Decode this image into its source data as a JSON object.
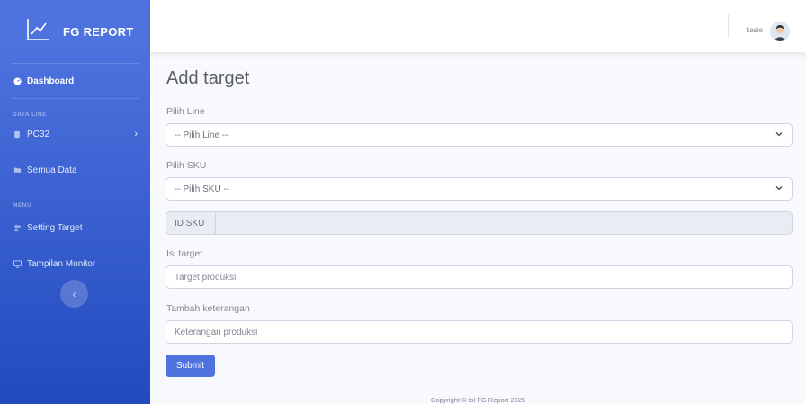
{
  "sidebar": {
    "brand": "FG REPORT",
    "dashboard": "Dashboard",
    "heading_data_line": "DATA LINE",
    "pc32": "PC32",
    "semua_data": "Semua Data",
    "heading_menu": "MENU",
    "setting_target": "Setting Target",
    "tampilan_monitor": "Tampilan Monitor"
  },
  "topbar": {
    "user": "kasie"
  },
  "form": {
    "title": "Add target",
    "line_label": "Pilih Line",
    "line_value": "-- Pilih Line --",
    "sku_label": "Pilih SKU",
    "sku_value": "-- Pilih SKU --",
    "id_sku_addon": "ID SKU",
    "target_label": "Isi target",
    "target_placeholder": "Target produksi",
    "note_label": "Tambah keterangan",
    "note_placeholder": "Keterangan produksi",
    "submit": "Submit"
  },
  "footer": {
    "copyright": "Copyright © fsl FG Report 2025"
  },
  "colors": {
    "primary": "#4e73df",
    "primary_dark": "#224abe"
  }
}
